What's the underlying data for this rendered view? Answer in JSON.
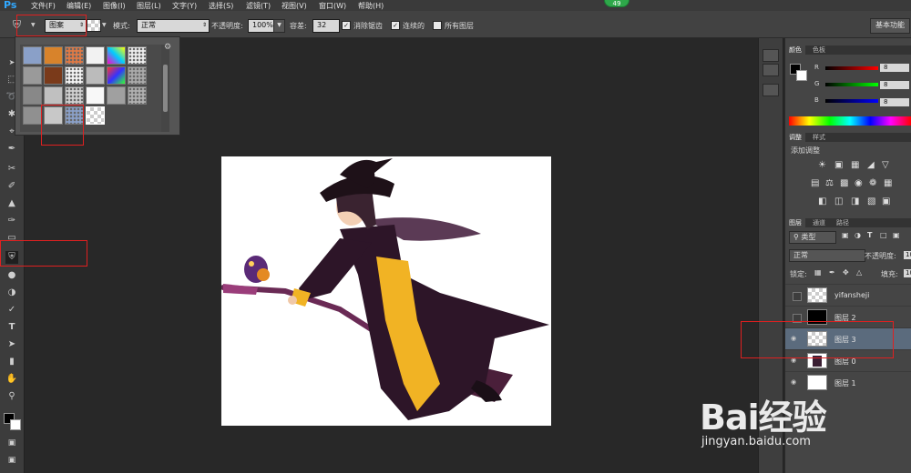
{
  "app": {
    "logo": "Ps",
    "badge": "49"
  },
  "menu": {
    "items": [
      "文件(F)",
      "编辑(E)",
      "图像(I)",
      "图层(L)",
      "文字(Y)",
      "选择(S)",
      "滤镜(T)",
      "视图(V)",
      "窗口(W)",
      "帮助(H)"
    ]
  },
  "options": {
    "fill_source": "图案",
    "mode_label": "模式:",
    "mode_value": "正常",
    "opacity_label": "不透明度:",
    "opacity_value": "100%",
    "tolerance_label": "容差:",
    "tolerance_value": "32",
    "antialias_label": "消除锯齿",
    "antialias_checked": true,
    "contiguous_label": "连续的",
    "contiguous_checked": true,
    "all_layers_label": "所有图层",
    "all_layers_checked": false,
    "workspace": "基本功能"
  },
  "patterns": {
    "count": 22,
    "selected_index": 21
  },
  "panels": {
    "color": {
      "tabs": [
        "颜色",
        "色板"
      ],
      "channels": [
        {
          "label": "R",
          "value": "8",
          "color": "#cc2222"
        },
        {
          "label": "G",
          "value": "8",
          "color": "#22aa22"
        },
        {
          "label": "B",
          "value": "8",
          "color": "#2222cc"
        }
      ]
    },
    "adjustments": {
      "tabs": [
        "调整",
        "样式"
      ],
      "title": "添加调整"
    },
    "layers": {
      "tabs": [
        "图层",
        "通道",
        "路径"
      ],
      "filter_label": "类型",
      "blend_mode": "正常",
      "opacity_label": "不透明度:",
      "opacity_value": "10",
      "lock_label": "锁定:",
      "fill_label": "填充:",
      "fill_value": "10",
      "items": [
        {
          "name": "yifansheji",
          "visible": false,
          "selected": false
        },
        {
          "name": "图层 2",
          "visible": false,
          "selected": false
        },
        {
          "name": "图层 3",
          "visible": true,
          "selected": true
        },
        {
          "name": "图层 0",
          "visible": true,
          "selected": false
        },
        {
          "name": "图层 1",
          "visible": true,
          "selected": false
        }
      ]
    }
  },
  "watermark": {
    "brand": "Bai经验",
    "url": "jingyan.baidu.com"
  }
}
